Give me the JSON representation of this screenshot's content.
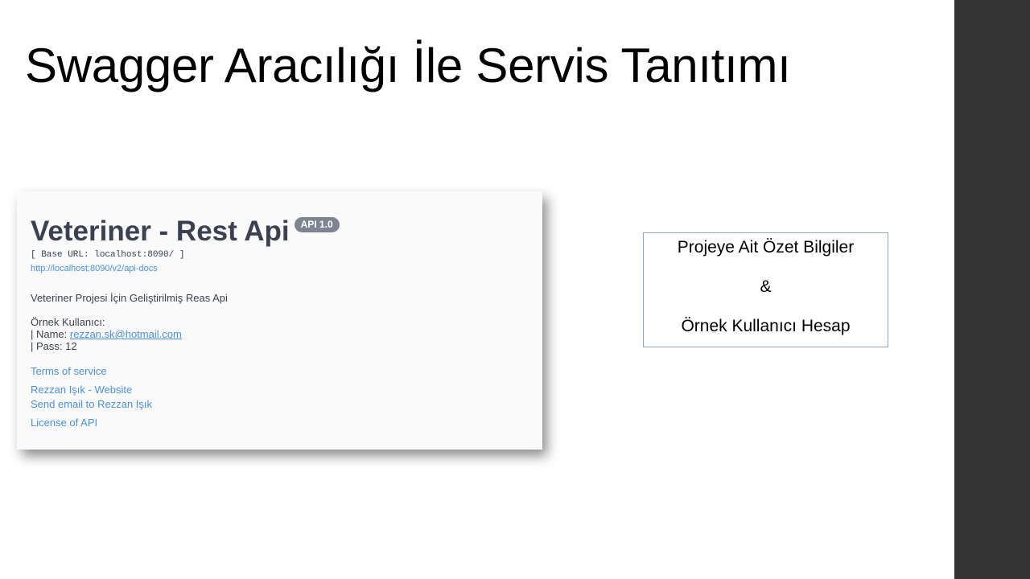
{
  "slide": {
    "title": "Swagger Aracılığı İle Servis Tanıtımı"
  },
  "swagger": {
    "api_title": "Veteriner - Rest Api",
    "version_badge": "API 1.0",
    "base_url": "[ Base URL: localhost:8090/ ]",
    "docs_link": "http://localhost:8090/v2/api-docs",
    "description": "Veteriner Projesi İçin Geliştirilmiş Reas Api",
    "sample_user": {
      "heading": "Örnek Kullanıcı:",
      "name_label": "| Name: ",
      "name_value": "rezzan.sk@hotmail.com",
      "pass_line": "| Pass: 12"
    },
    "links": {
      "terms": "Terms of service",
      "website": "Rezzan Işık - Website",
      "email": "Send email to Rezzan Işık",
      "license": "License of API"
    }
  },
  "info_box": {
    "line1": "Projeye Ait Özet Bilgiler",
    "line2": "&",
    "line3": "Örnek Kullanıcı Hesap"
  },
  "colors": {
    "right_bar": "#333333",
    "link": "#4990e2",
    "title_text": "#3b4151",
    "badge": "#7d8492"
  }
}
